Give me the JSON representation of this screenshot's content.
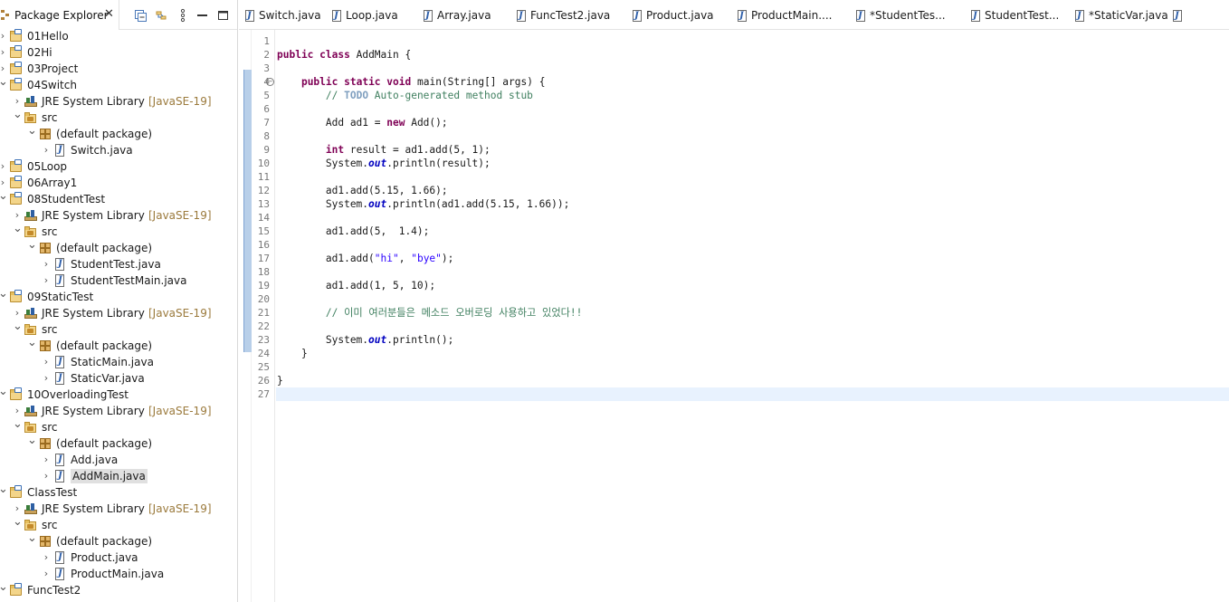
{
  "explorer": {
    "tab_label": "Package Explorer",
    "close_glyph": "✕",
    "toolbar_icons": [
      "collapse-all-icon",
      "link-with-editor-icon",
      "view-menu-icon",
      "minimize-icon",
      "maximize-icon"
    ],
    "rows": [
      {
        "label": "01Hello",
        "type": "project",
        "level": 0,
        "expanded": false
      },
      {
        "label": "02Hi",
        "type": "project",
        "level": 0,
        "expanded": false
      },
      {
        "label": "03Project",
        "type": "project",
        "level": 0,
        "expanded": false
      },
      {
        "label": "04Switch",
        "type": "project",
        "level": 0,
        "expanded": true
      },
      {
        "label": "JRE System Library",
        "decoration": "[JavaSE-19]",
        "type": "library",
        "level": 1,
        "expanded": false
      },
      {
        "label": "src",
        "type": "src",
        "level": 1,
        "expanded": true
      },
      {
        "label": "(default package)",
        "type": "package",
        "level": 2,
        "expanded": true
      },
      {
        "label": "Switch.java",
        "type": "java",
        "level": 3,
        "expanded": false
      },
      {
        "label": "05Loop",
        "type": "project",
        "level": 0,
        "expanded": false
      },
      {
        "label": "06Array1",
        "type": "project",
        "level": 0,
        "expanded": false
      },
      {
        "label": "08StudentTest",
        "type": "project",
        "level": 0,
        "expanded": true
      },
      {
        "label": "JRE System Library",
        "decoration": "[JavaSE-19]",
        "type": "library",
        "level": 1,
        "expanded": false
      },
      {
        "label": "src",
        "type": "src",
        "level": 1,
        "expanded": true
      },
      {
        "label": "(default package)",
        "type": "package",
        "level": 2,
        "expanded": true
      },
      {
        "label": "StudentTest.java",
        "type": "java",
        "level": 3,
        "expanded": false
      },
      {
        "label": "StudentTestMain.java",
        "type": "java",
        "level": 3,
        "expanded": false
      },
      {
        "label": "09StaticTest",
        "type": "project",
        "level": 0,
        "expanded": true
      },
      {
        "label": "JRE System Library",
        "decoration": "[JavaSE-19]",
        "type": "library",
        "level": 1,
        "expanded": false
      },
      {
        "label": "src",
        "type": "src",
        "level": 1,
        "expanded": true
      },
      {
        "label": "(default package)",
        "type": "package",
        "level": 2,
        "expanded": true
      },
      {
        "label": "StaticMain.java",
        "type": "java",
        "level": 3,
        "expanded": false
      },
      {
        "label": "StaticVar.java",
        "type": "java",
        "level": 3,
        "expanded": false
      },
      {
        "label": "10OverloadingTest",
        "type": "project",
        "level": 0,
        "expanded": true
      },
      {
        "label": "JRE System Library",
        "decoration": "[JavaSE-19]",
        "type": "library",
        "level": 1,
        "expanded": false
      },
      {
        "label": "src",
        "type": "src",
        "level": 1,
        "expanded": true
      },
      {
        "label": "(default package)",
        "type": "package",
        "level": 2,
        "expanded": true
      },
      {
        "label": "Add.java",
        "type": "java",
        "level": 3,
        "expanded": false
      },
      {
        "label": "AddMain.java",
        "type": "java",
        "level": 3,
        "expanded": false,
        "selected": true
      },
      {
        "label": "ClassTest",
        "type": "project",
        "level": 0,
        "expanded": true
      },
      {
        "label": "JRE System Library",
        "decoration": "[JavaSE-19]",
        "type": "library",
        "level": 1,
        "expanded": false
      },
      {
        "label": "src",
        "type": "src",
        "level": 1,
        "expanded": true
      },
      {
        "label": "(default package)",
        "type": "package",
        "level": 2,
        "expanded": true
      },
      {
        "label": "Product.java",
        "type": "java",
        "level": 3,
        "expanded": false
      },
      {
        "label": "ProductMain.java",
        "type": "java",
        "level": 3,
        "expanded": false
      },
      {
        "label": "FuncTest2",
        "type": "project",
        "level": 0,
        "expanded": true
      }
    ]
  },
  "editor": {
    "tabs": [
      {
        "label": "Switch.java"
      },
      {
        "label": "Loop.java"
      },
      {
        "label": "Array.java"
      },
      {
        "label": "FuncTest2.java"
      },
      {
        "label": "Product.java"
      },
      {
        "label": "ProductMain...."
      },
      {
        "label": "*StudentTes..."
      },
      {
        "label": "StudentTest..."
      },
      {
        "label": "*StaticVar.java"
      }
    ],
    "current_line": 27,
    "lines": [
      {
        "n": "1",
        "code": ""
      },
      {
        "n": "2",
        "code": "public class AddMain {"
      },
      {
        "n": "3",
        "code": ""
      },
      {
        "n": "4",
        "code": "    public static void main(String[] args) {",
        "fold": true
      },
      {
        "n": "5",
        "code": "        // TODO Auto-generated method stub"
      },
      {
        "n": "6",
        "code": ""
      },
      {
        "n": "7",
        "code": "        Add ad1 = new Add();"
      },
      {
        "n": "8",
        "code": ""
      },
      {
        "n": "9",
        "code": "        int result = ad1.add(5, 1);"
      },
      {
        "n": "10",
        "code": "        System.out.println(result);"
      },
      {
        "n": "11",
        "code": ""
      },
      {
        "n": "12",
        "code": "        ad1.add(5.15, 1.66);"
      },
      {
        "n": "13",
        "code": "        System.out.println(ad1.add(5.15, 1.66));"
      },
      {
        "n": "14",
        "code": ""
      },
      {
        "n": "15",
        "code": "        ad1.add(5,  1.4);"
      },
      {
        "n": "16",
        "code": ""
      },
      {
        "n": "17",
        "code": "        ad1.add(\"hi\", \"bye\");"
      },
      {
        "n": "18",
        "code": ""
      },
      {
        "n": "19",
        "code": "        ad1.add(1, 5, 10);"
      },
      {
        "n": "20",
        "code": ""
      },
      {
        "n": "21",
        "code": "        // 이미 여러분들은 메소드 오버로딩 사용하고 있었다!!"
      },
      {
        "n": "22",
        "code": ""
      },
      {
        "n": "23",
        "code": "        System.out.println();"
      },
      {
        "n": "24",
        "code": "    }"
      },
      {
        "n": "25",
        "code": ""
      },
      {
        "n": "26",
        "code": "}"
      },
      {
        "n": "27",
        "code": ""
      }
    ]
  },
  "colors": {
    "keyword": "#7f0055",
    "comment": "#3f7f5f",
    "string": "#2a00ff",
    "static_field": "#0000c0",
    "current_line": "#e8f2fe",
    "selection": "#e0e0e0",
    "library_decoration": "#9b7a3c"
  }
}
